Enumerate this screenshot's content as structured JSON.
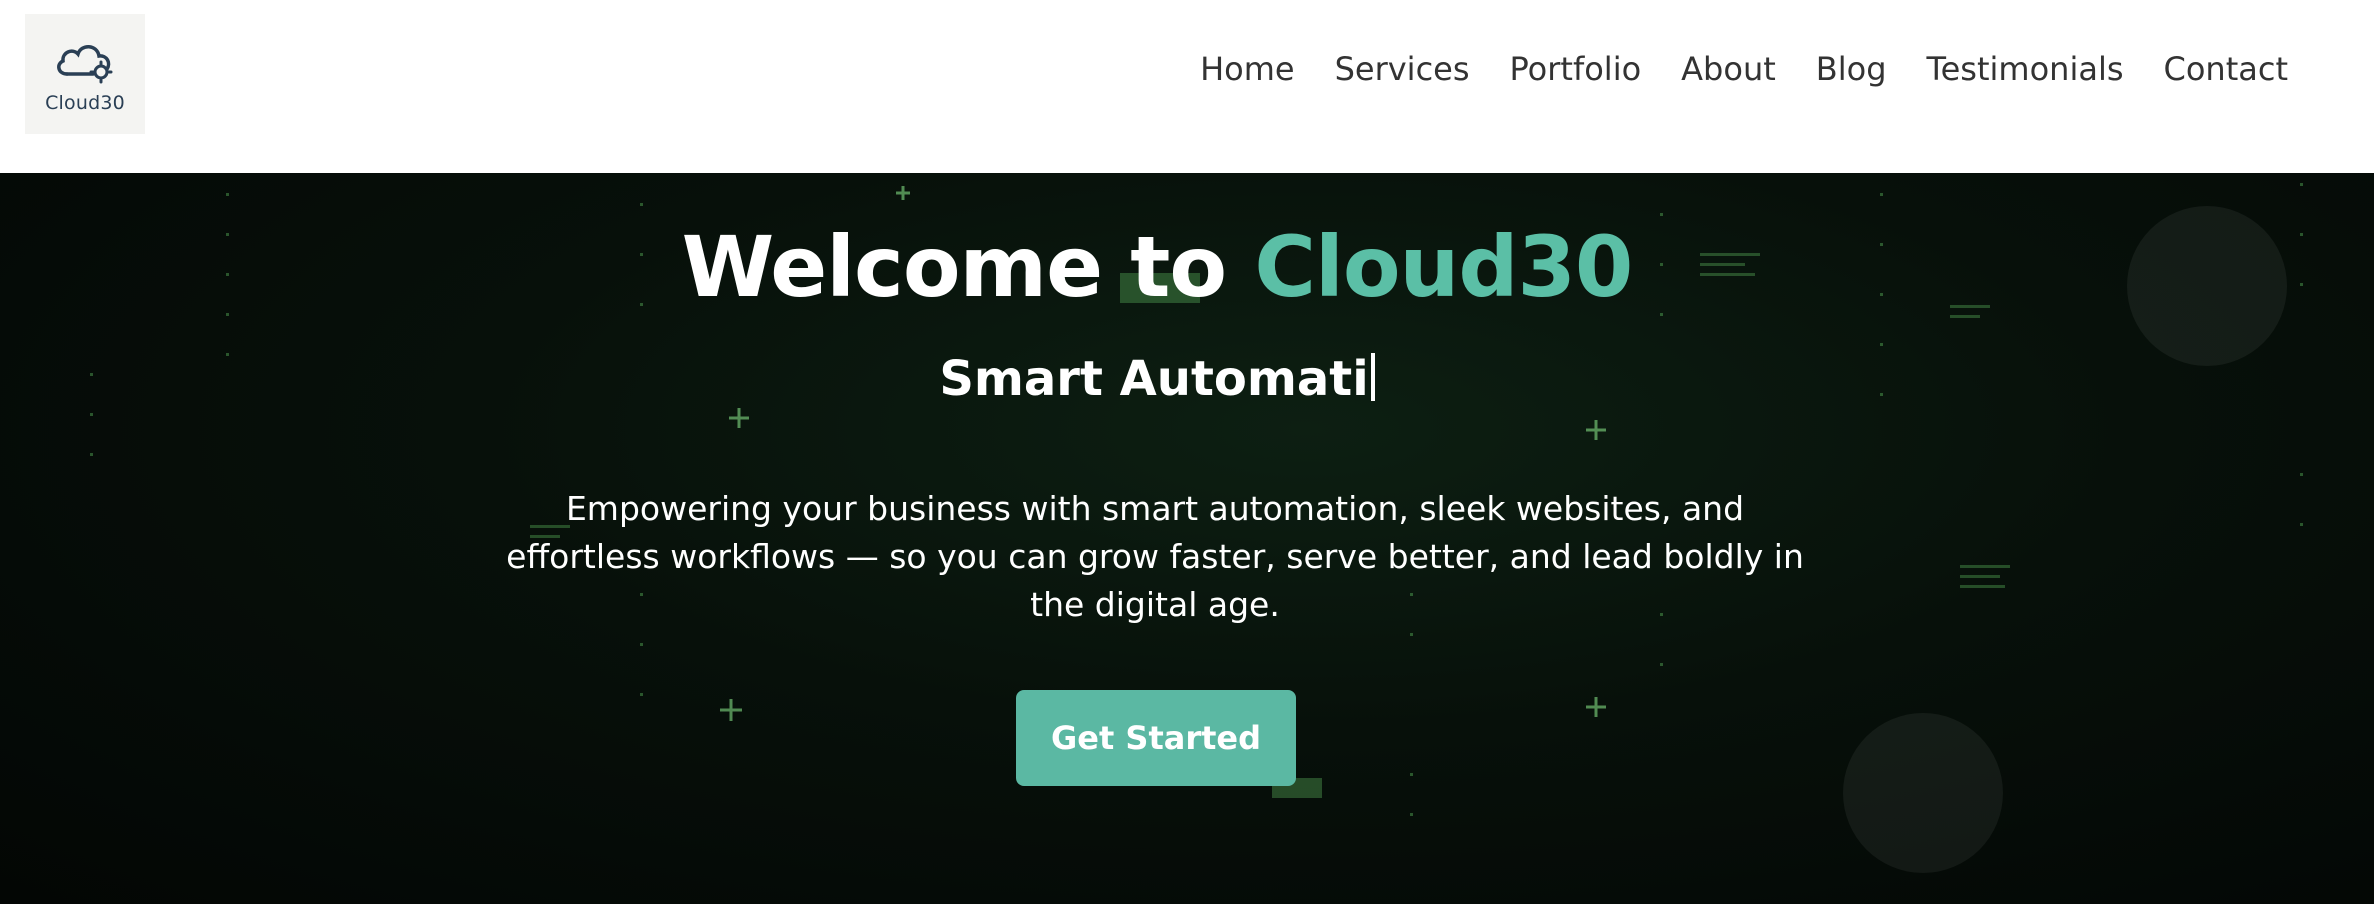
{
  "brand": {
    "name": "Cloud30",
    "logo_icon": "cloud-gear-icon",
    "logo_color": "#2a3f55"
  },
  "nav": {
    "items": [
      {
        "label": "Home"
      },
      {
        "label": "Services"
      },
      {
        "label": "Portfolio"
      },
      {
        "label": "About"
      },
      {
        "label": "Blog"
      },
      {
        "label": "Testimonials"
      },
      {
        "label": "Contact"
      }
    ]
  },
  "hero": {
    "title_prefix": "Welcome to",
    "title_accent": "Cloud30",
    "subtitle_typed": "Smart Automati",
    "description": "Empowering your business with smart automation, sleek websites, and effortless workflows — so you can grow faster, serve better, and lead boldly in the digital age.",
    "cta_label": "Get Started"
  },
  "colors": {
    "accent": "#5bbfa6",
    "button": "#5bb8a3",
    "hero_background": "#050a06",
    "matrix_green": "#6fdc6f"
  }
}
